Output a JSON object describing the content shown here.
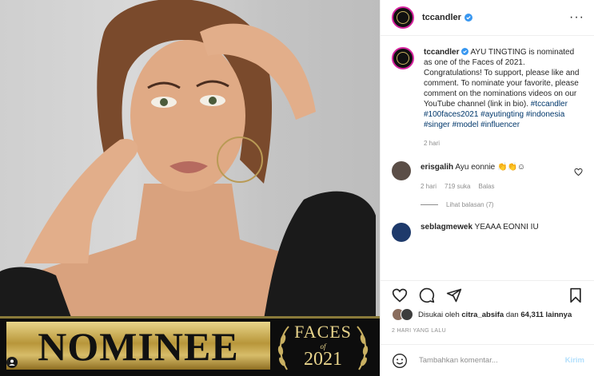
{
  "media": {
    "banner_main": "NOMINEE",
    "banner_badge_title": "FACES",
    "banner_badge_of": "of",
    "banner_badge_year": "2021"
  },
  "post": {
    "username": "tccandler",
    "more_icon": "more-icon",
    "caption": {
      "text": "AYU TINGTING is nominated as one of the Faces of 2021.  Congratulations!  To support, please like and comment.  To nominate your favorite,  please comment on the nominations videos on our YouTube channel (link in bio).",
      "hashtags": "#tccandler #100faces2021 #ayutingting #indonesia #singer #model #influencer",
      "time": "2 hari"
    },
    "comments": [
      {
        "username": "erisgalih",
        "text": "Ayu eonnie 👏👏☺",
        "time": "2 hari",
        "likes": "719 suka",
        "reply": "Balas",
        "view_replies": "Lihat balasan (7)"
      },
      {
        "username": "seblagmewek",
        "text": "YEAAA EONNI IU"
      }
    ],
    "likes_text_prefix": "Disukai oleh",
    "likes_user": "citra_absifa",
    "likes_and": "dan",
    "likes_count": "64,311 lainnya",
    "date": "2 HARI YANG LALU",
    "comment_placeholder": "Tambahkan komentar...",
    "post_button": "Kirim"
  },
  "colors": {
    "link": "#00376b",
    "muted": "#8e8e8e",
    "post_button": "#b2dffc",
    "verified": "#3897f0"
  }
}
